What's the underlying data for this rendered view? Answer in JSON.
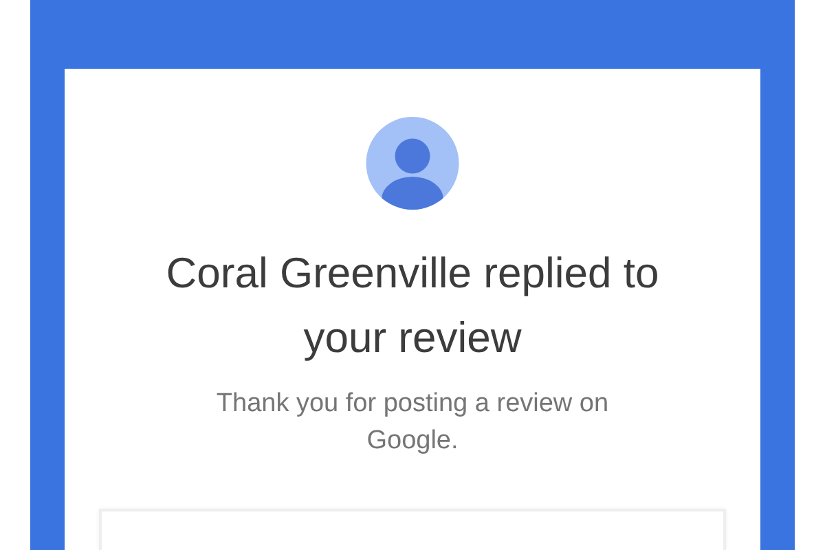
{
  "notification": {
    "title": "Coral Greenville replied to your review",
    "message": "Thank you for posting a review on Google."
  }
}
